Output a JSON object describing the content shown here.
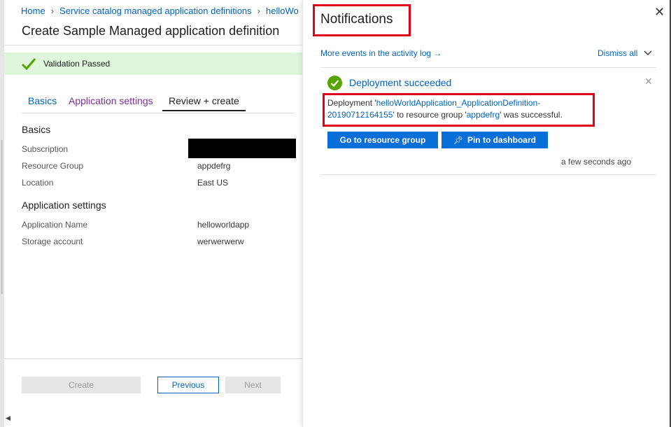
{
  "breadcrumb": {
    "items": [
      "Home",
      "Service catalog managed application definitions",
      "helloWo"
    ]
  },
  "blade": {
    "title": "Create Sample Managed application definition",
    "validation_text": "Validation Passed",
    "tabs": [
      {
        "label": "Basics"
      },
      {
        "label": "Application settings"
      },
      {
        "label": "Review + create"
      }
    ],
    "basics": {
      "heading": "Basics",
      "rows": [
        {
          "label": "Subscription",
          "value": ""
        },
        {
          "label": "Resource Group",
          "value": "appdefrg"
        },
        {
          "label": "Location",
          "value": "East US"
        }
      ]
    },
    "app_settings": {
      "heading": "Application settings",
      "rows": [
        {
          "label": "Application Name",
          "value": "helloworldapp"
        },
        {
          "label": "Storage account",
          "value": "werwerwerw"
        }
      ]
    },
    "buttons": {
      "create": "Create",
      "previous": "Previous",
      "next": "Next"
    }
  },
  "notifications": {
    "title": "Notifications",
    "activity_link": "More events in the activity log →",
    "dismiss_all": "Dismiss all",
    "item": {
      "heading": "Deployment succeeded",
      "msg_prefix": "Deployment '",
      "msg_definition": "helloWorldApplication_ApplicationDefinition-20190712164155",
      "msg_middle": "' to resource group '",
      "msg_rg": "appdefrg",
      "msg_suffix": "' was successful.",
      "goto_button": "Go to resource group",
      "pin_button": "Pin to dashboard",
      "timestamp": "a few seconds ago"
    }
  },
  "colors": {
    "link": "#0063c1",
    "success_green": "#57a300",
    "validation_bg": "#dff6dd",
    "highlight_red": "#e0001a",
    "primary_button": "#0a6ed8"
  }
}
